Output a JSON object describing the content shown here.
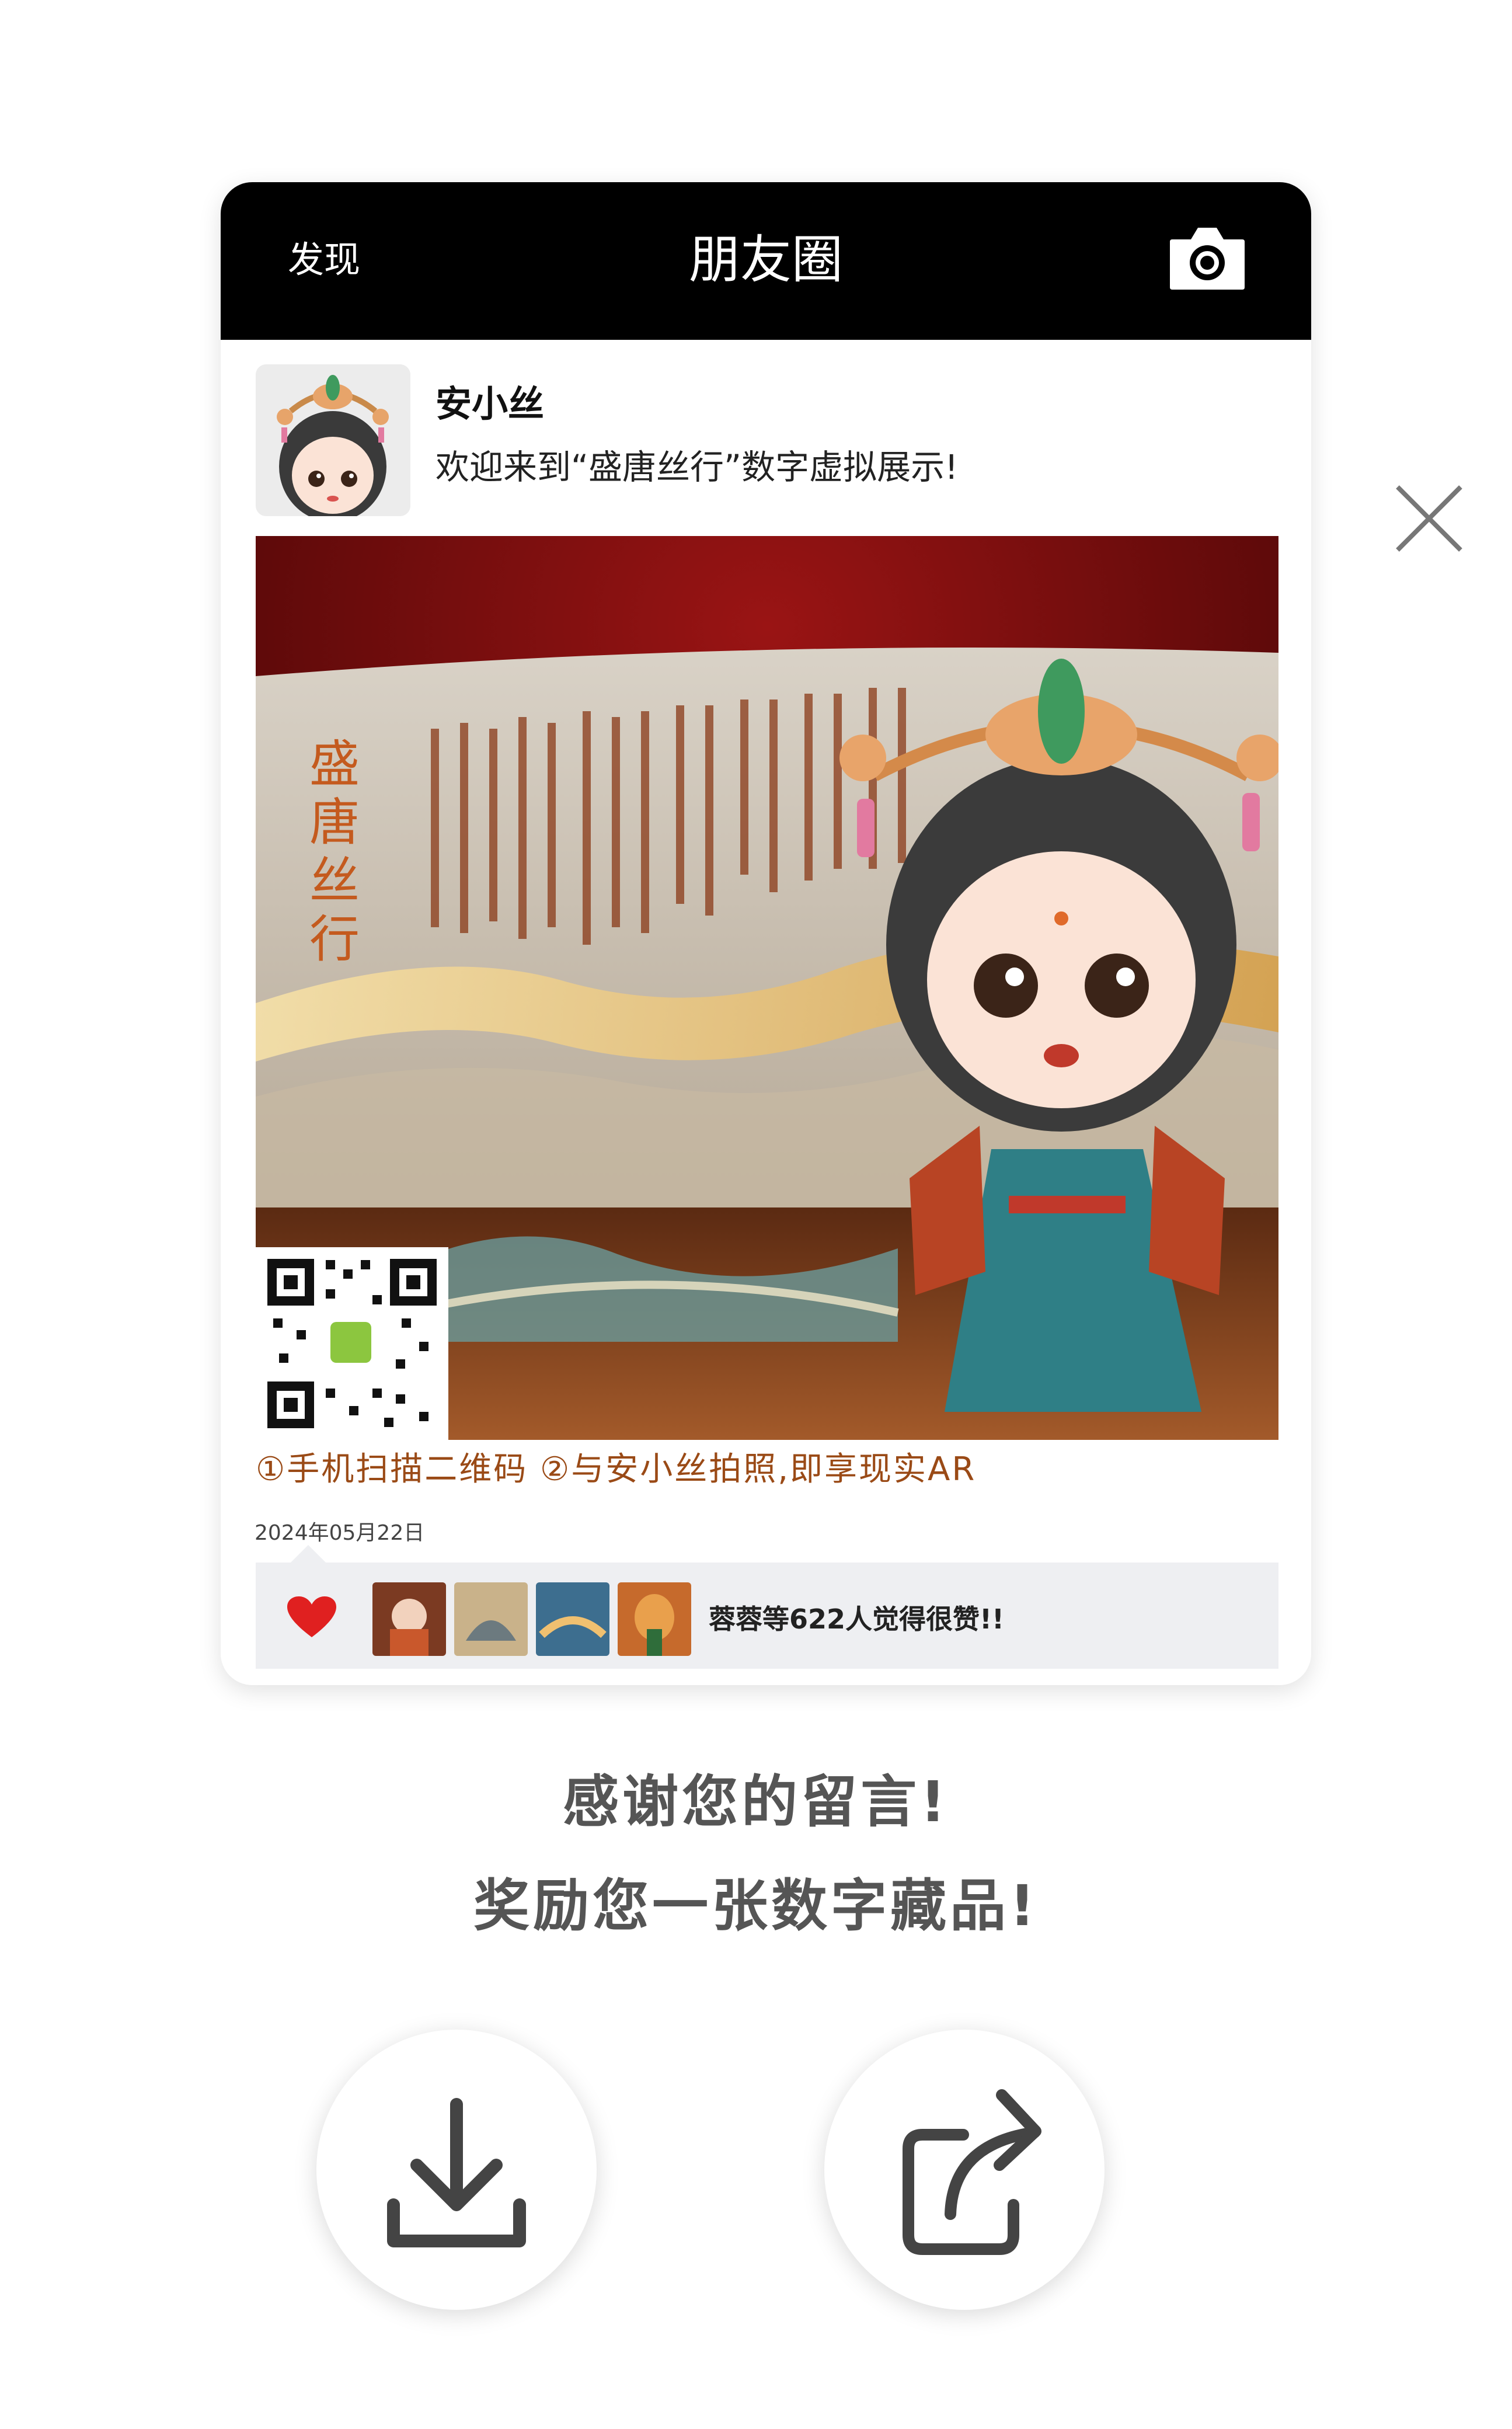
{
  "topbar": {
    "back_label": "发现",
    "title": "朋友圈",
    "camera_icon": "camera-icon"
  },
  "post": {
    "author_name": "安小丝",
    "text": "欢迎来到“盛唐丝行”数字虚拟展示!",
    "image": {
      "banner_text": "盛唐丝行",
      "qr_icon": "qr-code-icon"
    },
    "caption": "①手机扫描二维码 ②与安小丝拍照,即享现实AR",
    "date": "2024年05月22日"
  },
  "likes": {
    "icon": "heart-icon",
    "text": "蓉蓉等622人觉得很赞!!",
    "avatar_count": 4
  },
  "close_icon": "close-icon",
  "message": {
    "line1": "感谢您的留言!",
    "line2": "奖励您一张数字藏品!"
  },
  "actions": {
    "download_icon": "download-icon",
    "share_icon": "share-icon"
  },
  "colors": {
    "topbar": "#000000",
    "heart": "#e02020",
    "caption": "#9a4a16",
    "likes_bg": "#eeeff2"
  }
}
